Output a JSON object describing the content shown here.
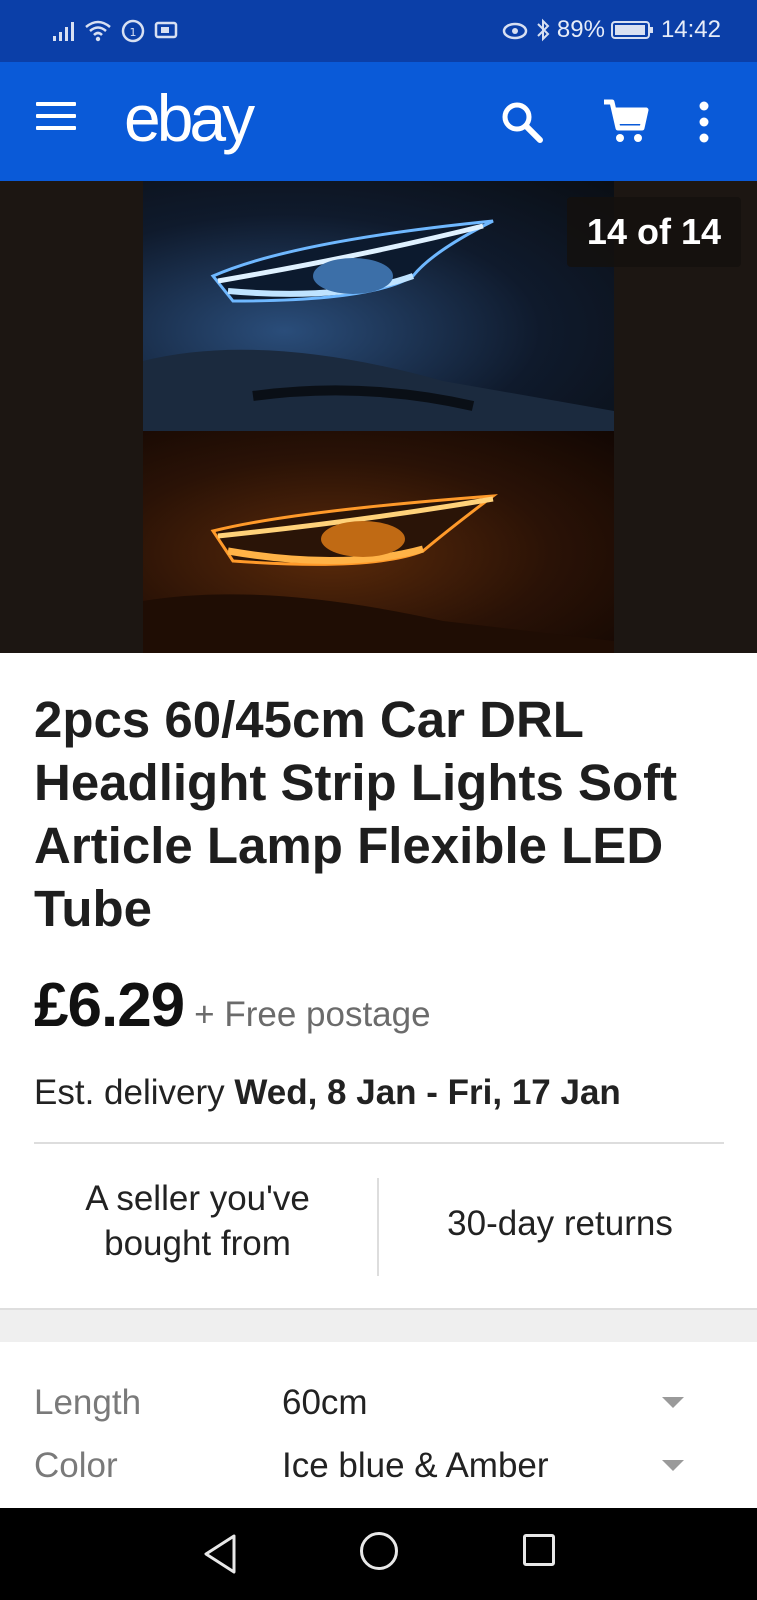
{
  "status_bar": {
    "battery": "89%",
    "time": "14:42"
  },
  "app_bar": {
    "logo": "ebay"
  },
  "gallery": {
    "counter": "14 of 14"
  },
  "listing": {
    "title": "2pcs 60/45cm Car DRL Headlight Strip Lights Soft Article Lamp Flexible LED Tube",
    "price": "£6.29",
    "postage": "+ Free postage",
    "delivery_label": "Est. delivery",
    "delivery_dates": "Wed, 8 Jan - Fri, 17 Jan",
    "badge_seller": "A seller you've bought from",
    "badge_returns": "30-day returns"
  },
  "options": [
    {
      "label": "Length",
      "value": "60cm"
    },
    {
      "label": "Color",
      "value": "Ice blue & Amber"
    }
  ],
  "colors": {
    "status_bar": "#0b3fa8",
    "app_bar": "#0a5ad8"
  }
}
